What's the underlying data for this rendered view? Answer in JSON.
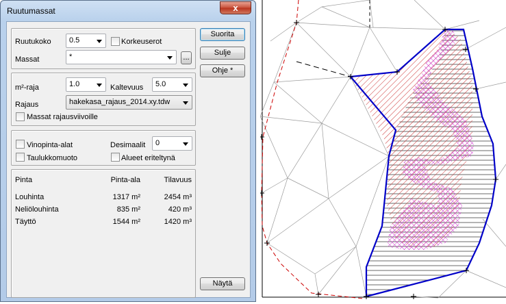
{
  "window": {
    "title": "Ruutumassat",
    "close_glyph": "x"
  },
  "settings": {
    "ruutukoko_label": "Ruutukoko",
    "ruutukoko_value": "0.5",
    "korkeuserot_label": "Korkeuserot",
    "massat_label": "Massat",
    "massat_value": "*",
    "browse_label": "..."
  },
  "limits": {
    "m2_label": "m²-raja",
    "m2_value": "1.0",
    "kaltevuus_label": "Kaltevuus",
    "kaltevuus_value": "5.0",
    "rajaus_label": "Rajaus",
    "rajaus_value": "hakekasa_rajaus_2014.xy.tdw",
    "rajausviivoille_label": "Massat rajausviivoille"
  },
  "options": {
    "vinopinta_label": "Vinopinta-alat",
    "desimaalit_label": "Desimaalit",
    "desimaalit_value": "0",
    "taulukko_label": "Taulukkomuoto",
    "alueet_label": "Alueet eriteltynä"
  },
  "results": {
    "headers": [
      "Pinta",
      "Pinta-ala",
      "Tilavuus"
    ],
    "rows": [
      {
        "name": "Louhinta",
        "area": "1317 m²",
        "volume": "2454 m³"
      },
      {
        "name": "Neliölouhinta",
        "area": "835 m²",
        "volume": "420 m³"
      },
      {
        "name": "Täyttö",
        "area": "1544 m²",
        "volume": "1420 m³"
      }
    ]
  },
  "buttons": {
    "suorita": "Suorita",
    "sulje": "Sulje",
    "ohje": "Ohje *",
    "nayta": "Näytä"
  },
  "colors": {
    "boundary": "#0000c8",
    "cut_hatch": "#cc3333",
    "neliolouhinta_hatch": "#cc33cc",
    "fill_hatch": "#000000",
    "dashed_boundary": "#cc0000",
    "triangulation": "#9a9a9a"
  }
}
